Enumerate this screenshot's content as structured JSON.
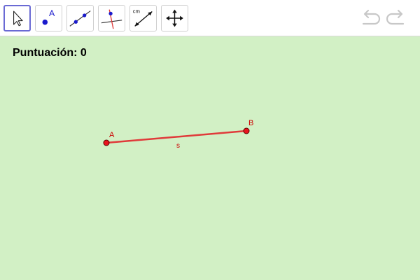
{
  "toolbar": {
    "tools": [
      {
        "name": "move-tool",
        "icon": "arrow-pointer-icon",
        "selected": true
      },
      {
        "name": "point-tool",
        "icon": "point-icon",
        "label": "A"
      },
      {
        "name": "line-tool",
        "icon": "line-icon"
      },
      {
        "name": "perpendicular-line-tool",
        "icon": "perpendicular-line-icon"
      },
      {
        "name": "distance-tool",
        "icon": "distance-icon",
        "label": "cm"
      },
      {
        "name": "move-graphics-view-tool",
        "icon": "move-arrows-icon"
      }
    ],
    "undo_icon": "undo-icon",
    "redo_icon": "redo-icon"
  },
  "score": {
    "label": "Puntuación: 0"
  },
  "construction": {
    "point_a_label": "A",
    "point_b_label": "B",
    "segment_label": "s"
  },
  "colors": {
    "background": "#d2f0c5",
    "segment": "#e03a3a",
    "point_fill": "#e8141e",
    "label": "#cc0000",
    "tool_blue": "#1a1acc",
    "selected_border": "#6a6ad4",
    "history_icon": "#c8c8c8"
  }
}
